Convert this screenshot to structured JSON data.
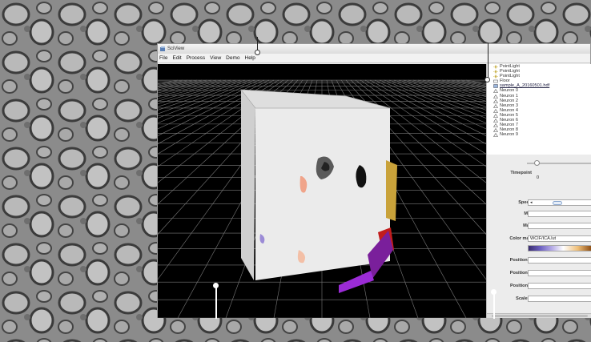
{
  "window": {
    "title": "SciView",
    "menu": [
      "File",
      "Edit",
      "Process",
      "View",
      "Demo",
      "Help"
    ]
  },
  "scene_tree": [
    {
      "label": "PointLight",
      "icon": "light-icon"
    },
    {
      "label": "PointLight",
      "icon": "light-icon"
    },
    {
      "label": "PointLight",
      "icon": "light-icon"
    },
    {
      "label": "Floor",
      "icon": "node-icon"
    },
    {
      "label": "sample_A_20160501.hdf",
      "icon": "volume-icon"
    },
    {
      "label": "Neuron 0",
      "icon": "mesh-icon"
    },
    {
      "label": "Neuron 1",
      "icon": "mesh-icon"
    },
    {
      "label": "Neuron 2",
      "icon": "mesh-icon"
    },
    {
      "label": "Neuron 3",
      "icon": "mesh-icon"
    },
    {
      "label": "Neuron 4",
      "icon": "mesh-icon"
    },
    {
      "label": "Neuron 5",
      "icon": "mesh-icon"
    },
    {
      "label": "Neuron 6",
      "icon": "mesh-icon"
    },
    {
      "label": "Neuron 7",
      "icon": "mesh-icon"
    },
    {
      "label": "Neuron 8",
      "icon": "mesh-icon"
    },
    {
      "label": "Neuron 9",
      "icon": "mesh-icon"
    }
  ],
  "properties": {
    "timepoint_label": "Timepoint",
    "timepoint_value": "0",
    "speed_label": "Speed",
    "min_label": "Min",
    "max_label": "Max",
    "colormap_label": "Color map",
    "colormap_value": "WCIF/ICA.lut",
    "position_x_label": "Position X",
    "position_y_label": "Position Y",
    "position_z_label": "Position Z",
    "scale_x_label": "Scale X"
  },
  "colors": {
    "viewport_bg": "#000000",
    "grid": "#8a8a8a",
    "volume": "#e9e9e9"
  }
}
